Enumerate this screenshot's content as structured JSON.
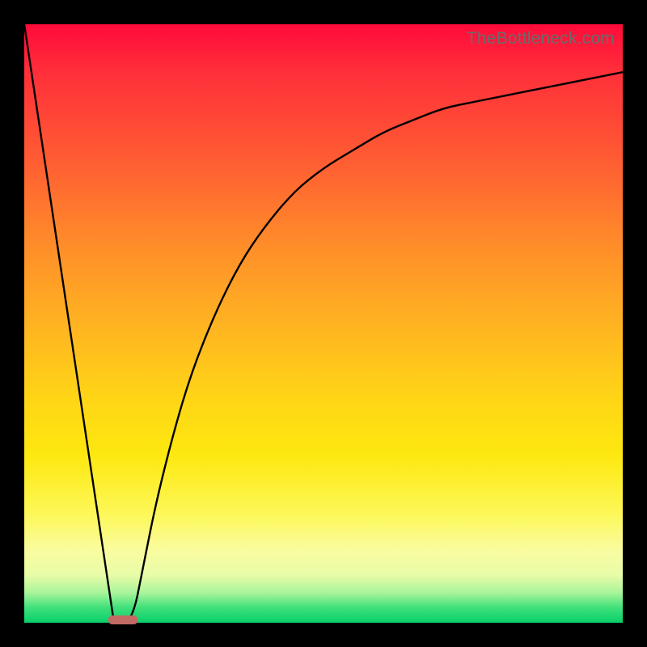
{
  "attribution": "TheBottleneck.com",
  "colors": {
    "frame": "#000000",
    "gradient_top": "#ff0a3a",
    "gradient_bottom": "#08cf6a",
    "curve": "#000000",
    "marker": "#c26a64",
    "attribution_text": "#6b6b6b"
  },
  "chart_data": {
    "type": "line",
    "title": "",
    "xlabel": "",
    "ylabel": "",
    "xlim": [
      0,
      100
    ],
    "ylim": [
      0,
      100
    ],
    "note": "Values are read from the plot at the precision implied by its rendering. y is 0 at the bottom (green) and 100 at the top (red). The background gradient encodes y (red high → green low). The curve descends linearly from the upper-left to ~y=0 at x≈15–18 then rises asymptotically toward ~y≈92 at x=100.",
    "series": [
      {
        "name": "curve-left-descent",
        "x": [
          0,
          3,
          6,
          9,
          12,
          15
        ],
        "values": [
          100,
          80,
          60,
          40,
          20,
          0
        ]
      },
      {
        "name": "curve-right-rise",
        "x": [
          18,
          20,
          22,
          25,
          28,
          32,
          36,
          40,
          45,
          50,
          55,
          60,
          65,
          70,
          75,
          80,
          85,
          90,
          95,
          100
        ],
        "values": [
          0,
          10,
          20,
          32,
          42,
          52,
          60,
          66,
          72,
          76,
          79,
          82,
          84,
          86,
          87,
          88,
          89,
          90,
          91,
          92
        ]
      }
    ],
    "annotations": [
      {
        "name": "min-marker",
        "shape": "rounded-bar",
        "x_center": 16.5,
        "y": 0,
        "width_x_units": 5
      }
    ]
  }
}
